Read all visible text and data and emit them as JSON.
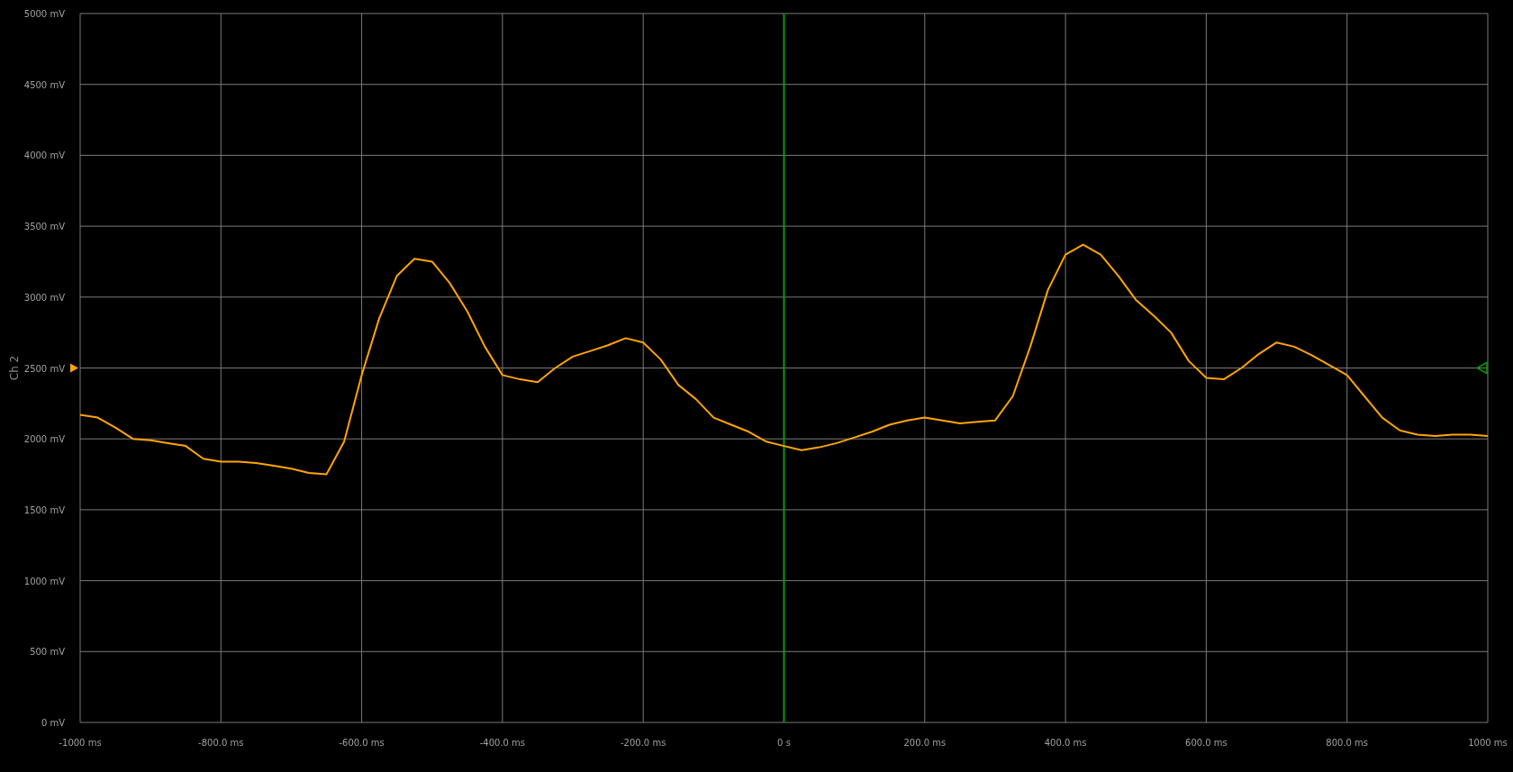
{
  "markers": {
    "offset": true,
    "trigger_level": true
  },
  "chart_data": {
    "type": "line",
    "grid": true,
    "xlim": [
      -1000,
      1000
    ],
    "ylim": [
      0,
      5000
    ],
    "ref_lines": [
      {
        "axis": "x",
        "value": 0,
        "color": "#0a9a0a"
      }
    ],
    "xticks": [
      {
        "value": -1000,
        "label": "-1000 ms"
      },
      {
        "value": -800,
        "label": "-800.0 ms"
      },
      {
        "value": -600,
        "label": "-600.0 ms"
      },
      {
        "value": -400,
        "label": "-400.0 ms"
      },
      {
        "value": -200,
        "label": "-200.0 ms"
      },
      {
        "value": 0,
        "label": "0 s"
      },
      {
        "value": 200,
        "label": "200.0 ms"
      },
      {
        "value": 400,
        "label": "400.0 ms"
      },
      {
        "value": 600,
        "label": "600.0 ms"
      },
      {
        "value": 800,
        "label": "800.0 ms"
      },
      {
        "value": 1000,
        "label": "1000 ms"
      }
    ],
    "yticks": [
      {
        "value": 0,
        "label": "0 mV"
      },
      {
        "value": 500,
        "label": "500 mV"
      },
      {
        "value": 1000,
        "label": "1000 mV"
      },
      {
        "value": 1500,
        "label": "1500 mV"
      },
      {
        "value": 2000,
        "label": "2000 mV"
      },
      {
        "value": 2500,
        "label": "2500 mV"
      },
      {
        "value": 3000,
        "label": "3000 mV"
      },
      {
        "value": 3500,
        "label": "3500 mV"
      },
      {
        "value": 4000,
        "label": "4000 mV"
      },
      {
        "value": 4500,
        "label": "4500 mV"
      },
      {
        "value": 5000,
        "label": "5000 mV"
      }
    ],
    "x": [
      -1000,
      -975,
      -950,
      -925,
      -900,
      -875,
      -850,
      -825,
      -800,
      -775,
      -750,
      -725,
      -700,
      -675,
      -650,
      -625,
      -600,
      -575,
      -550,
      -525,
      -500,
      -475,
      -450,
      -425,
      -400,
      -375,
      -350,
      -325,
      -300,
      -275,
      -250,
      -225,
      -200,
      -175,
      -150,
      -125,
      -100,
      -75,
      -50,
      -25,
      0,
      25,
      50,
      75,
      100,
      125,
      150,
      175,
      200,
      225,
      250,
      275,
      300,
      325,
      350,
      375,
      400,
      425,
      450,
      475,
      500,
      525,
      550,
      575,
      600,
      625,
      650,
      675,
      700,
      725,
      750,
      775,
      800,
      825,
      850,
      875,
      900,
      925,
      950,
      975,
      1000
    ],
    "series": [
      {
        "name": "Ch 2",
        "color": "#ffa500",
        "values": [
          2170,
          2150,
          2080,
          2000,
          1990,
          1970,
          1950,
          1860,
          1840,
          1840,
          1830,
          1810,
          1790,
          1760,
          1750,
          1980,
          2450,
          2850,
          3150,
          3270,
          3250,
          3100,
          2900,
          2650,
          2450,
          2420,
          2400,
          2500,
          2580,
          2620,
          2660,
          2710,
          2680,
          2560,
          2380,
          2280,
          2150,
          2100,
          2050,
          1980,
          1950,
          1920,
          1940,
          1970,
          2010,
          2050,
          2100,
          2130,
          2150,
          2130,
          2110,
          2120,
          2130,
          2300,
          2650,
          3050,
          3300,
          3370,
          3300,
          3150,
          2980,
          2870,
          2750,
          2550,
          2430,
          2420,
          2500,
          2600,
          2680,
          2650,
          2590,
          2520,
          2450,
          2300,
          2150,
          2060,
          2030,
          2020,
          2030,
          2030,
          2020
        ]
      }
    ]
  }
}
